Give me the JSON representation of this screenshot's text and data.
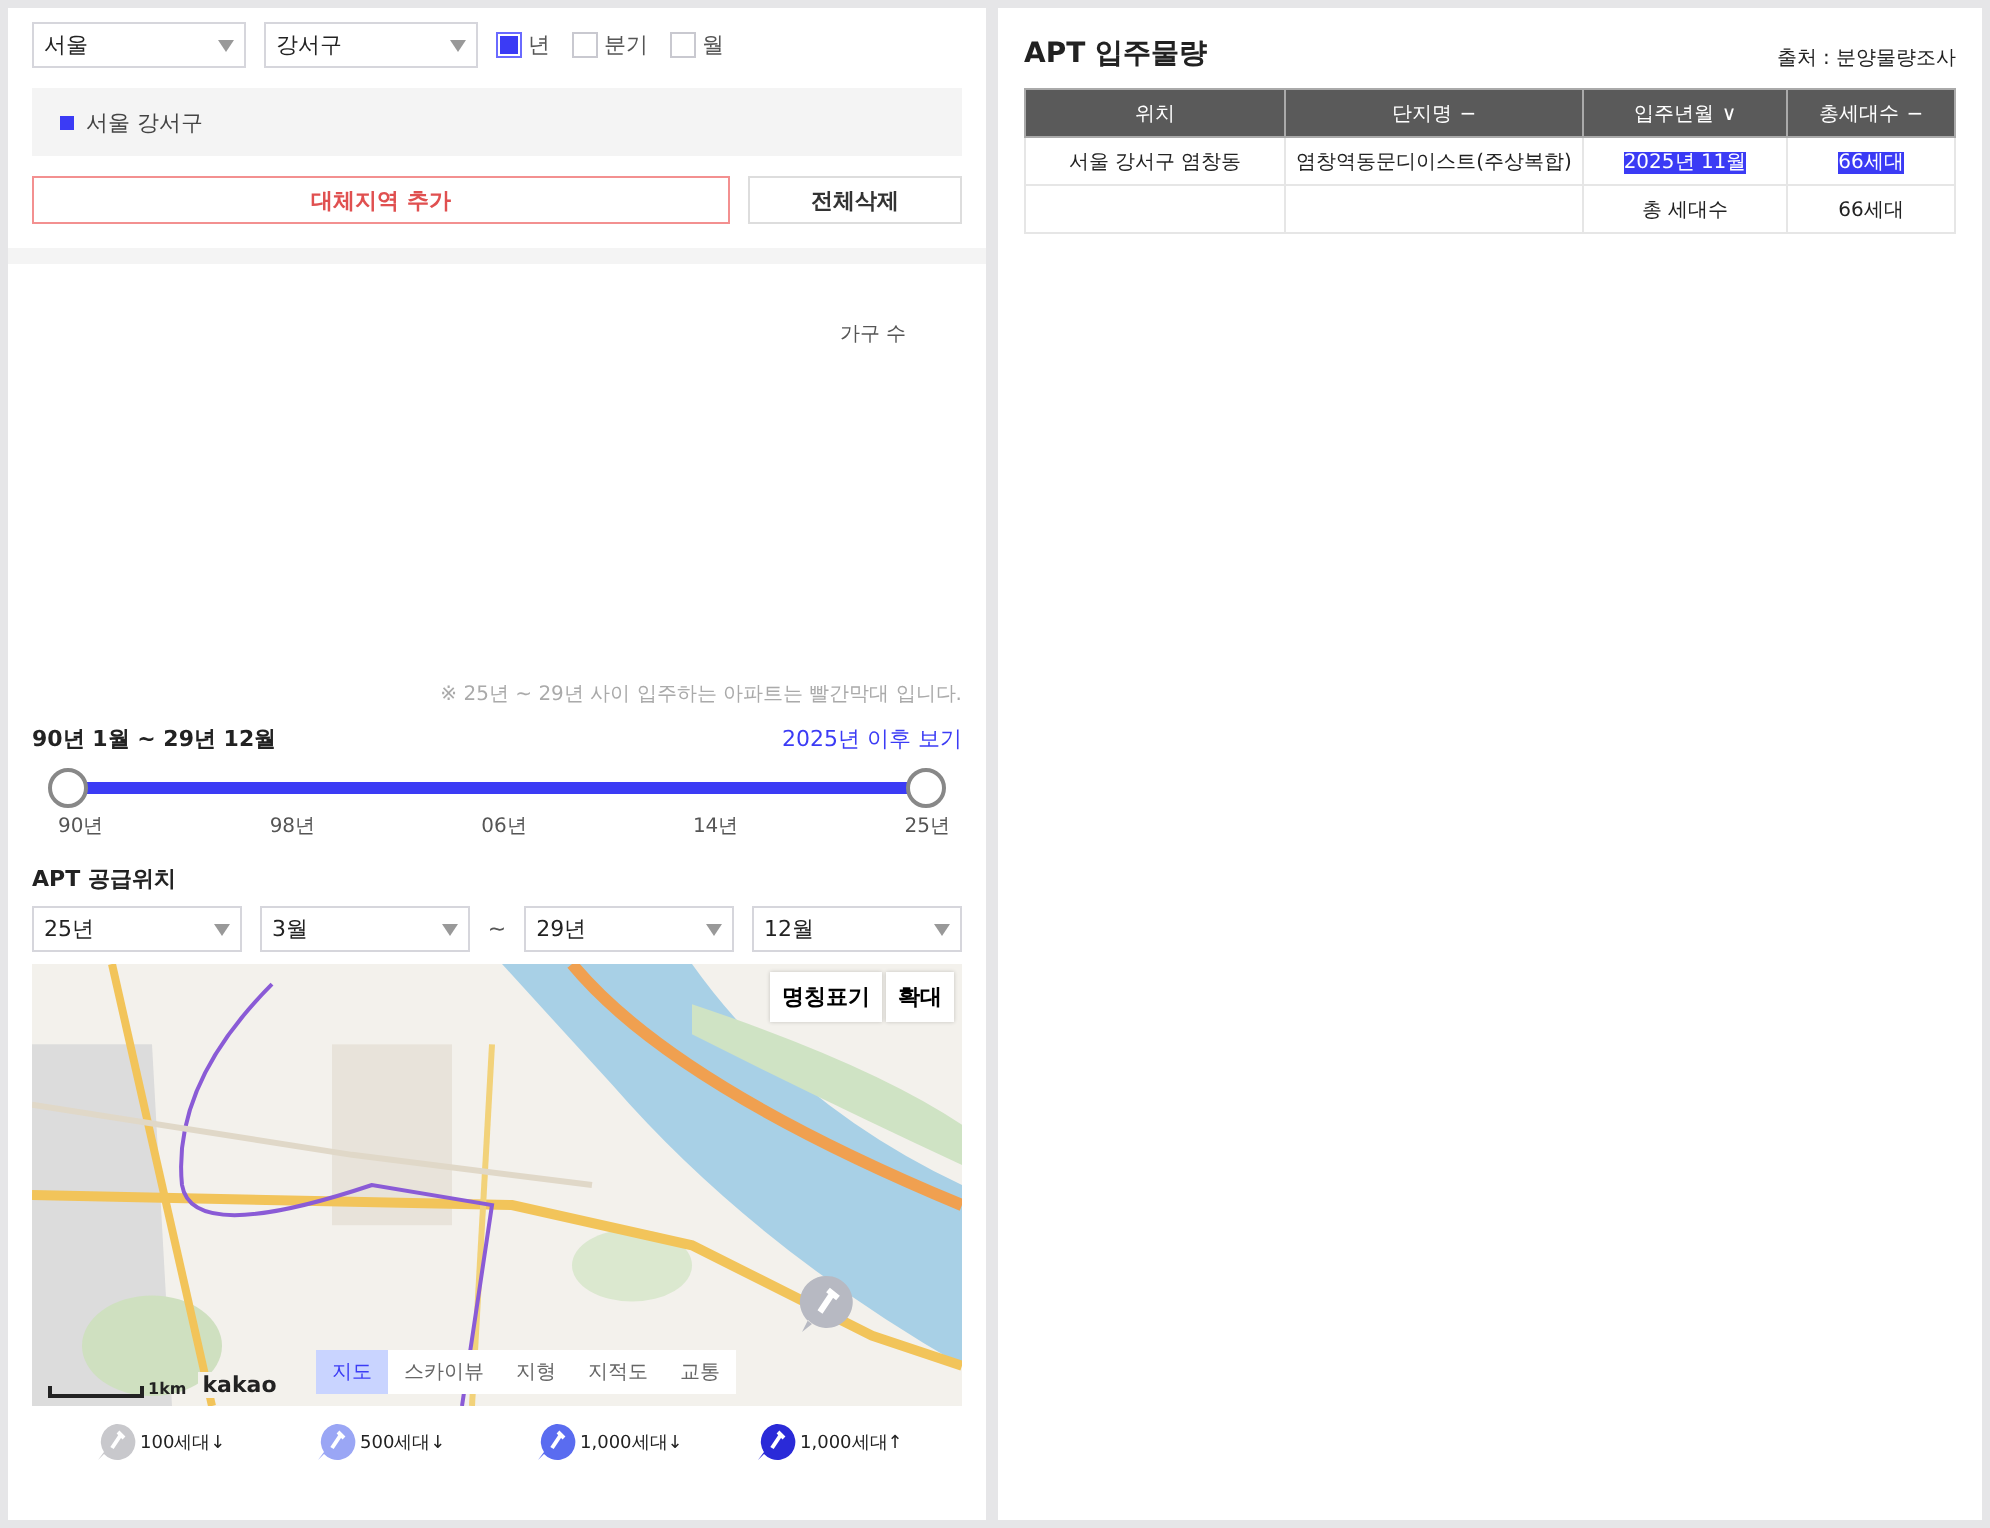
{
  "filters": {
    "selects": [
      {
        "value": "서울"
      },
      {
        "value": "강서구"
      }
    ],
    "periods": [
      {
        "label": "년",
        "checked": true
      },
      {
        "label": "분기",
        "checked": false
      },
      {
        "label": "월",
        "checked": false
      }
    ]
  },
  "regions": [
    {
      "label": "서울 강서구",
      "color": "#3b3bf5"
    }
  ],
  "buttons": [
    {
      "label": "대체지역 추가",
      "kind": "primary"
    },
    {
      "label": "전체삭제",
      "kind": "plain"
    }
  ],
  "chart": {
    "axis_label": "가구 수"
  },
  "note": "※ 25년 ~ 29년 사이 입주하는 아파트는 빨간막대 입니다.",
  "range": {
    "title": "90년 1월 ~ 29년 12월",
    "link": "2025년 이후 보기",
    "level": 1,
    "ticks": [
      "90년",
      "98년",
      "06년",
      "14년",
      "25년"
    ]
  },
  "supply": {
    "title": "APT 공급위치",
    "selects": [
      {
        "value": "25년"
      },
      {
        "value": "3월"
      },
      {
        "value": "29년"
      },
      {
        "value": "12월"
      }
    ],
    "separator": "~"
  },
  "map": {
    "kind": "picture",
    "buttons": [
      "명칭표기",
      "확대"
    ],
    "tabs": [
      {
        "label": "지도",
        "selected": true
      },
      {
        "label": "스카이뷰",
        "selected": false
      },
      {
        "label": "지형",
        "selected": false
      },
      {
        "label": "지적도",
        "selected": false
      },
      {
        "label": "교통",
        "selected": false
      }
    ],
    "scale": "1km",
    "brand": "kakao"
  },
  "legend": [
    {
      "label": "100세대↓",
      "color": "#c8c8cc"
    },
    {
      "label": "500세대↓",
      "color": "#9aa6f5"
    },
    {
      "label": "1,000세대↓",
      "color": "#5a6cf0"
    },
    {
      "label": "1,000세대↑",
      "color": "#2a2ad8"
    }
  ],
  "table": {
    "title": "APT 입주물량",
    "source": "출처 : 분양물량조사",
    "columns": [
      {
        "label": "위치"
      },
      {
        "label": "단지명",
        "marker": "−"
      },
      {
        "label": "입주년월",
        "marker": "∨"
      },
      {
        "label": "총세대수",
        "marker": "−"
      }
    ],
    "rows": [
      {
        "cells": [
          {
            "kind": "text",
            "text": "서울 강서구 염창동",
            "highlighted": false
          },
          {
            "kind": "text",
            "text": "염창역동문디이스트(주상복합)",
            "highlighted": false
          },
          {
            "kind": "text",
            "text": "2025년 11월",
            "highlighted": true
          },
          {
            "kind": "text",
            "text": "66세대",
            "highlighted": true
          }
        ]
      },
      {
        "cells": [
          {
            "kind": "blank"
          },
          {
            "kind": "blank"
          },
          {
            "kind": "text",
            "text": "총 세대수",
            "highlighted": false
          },
          {
            "kind": "text",
            "text": "66세대",
            "highlighted": false
          }
        ]
      }
    ]
  }
}
